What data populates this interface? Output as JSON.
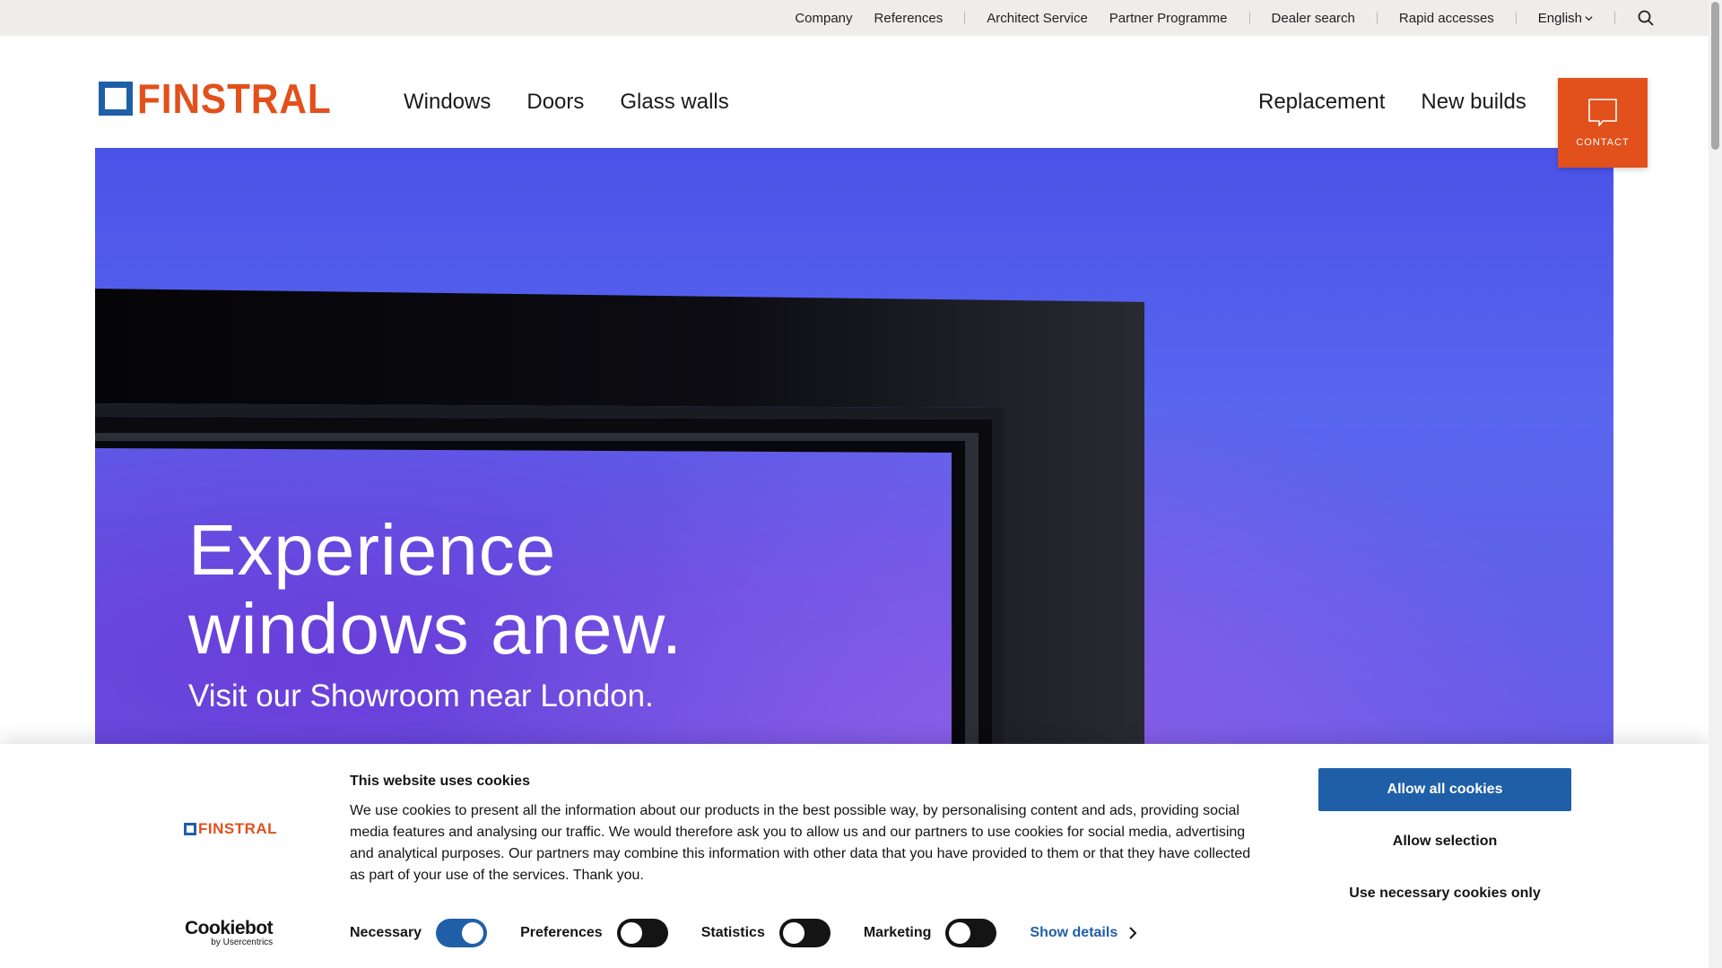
{
  "topbar": {
    "links_a": [
      "Company",
      "References"
    ],
    "links_b": [
      "Architect Service",
      "Partner Programme"
    ],
    "links_c": [
      "Dealer search"
    ],
    "links_d": [
      "Rapid accesses"
    ],
    "language": "English",
    "search_icon": "search-icon"
  },
  "header": {
    "logo_text": "FINSTRAL",
    "nav_left": [
      "Windows",
      "Doors",
      "Glass walls"
    ],
    "nav_right": [
      "Replacement",
      "New builds"
    ],
    "contact_label": "CONTACT",
    "contact_icon": "speech-bubble-icon"
  },
  "hero": {
    "title_line1": "Experience",
    "title_line2": "windows anew.",
    "subtitle": "Visit our Showroom near London."
  },
  "cookie": {
    "logo_text": "FINSTRAL",
    "cookiebot_name": "Cookiebot",
    "cookiebot_by": "by Usercentrics",
    "title": "This website uses cookies",
    "text": "We use cookies to present all the information about our products in the best possible way, by personalising content and ads, providing social media features and analysing our traffic. We would therefore ask you to allow us and our partners to use cookies for social media, advertising and analytical purposes. Our partners may combine this information with other data that you have provided to them or that they have collected as part of your use of the services. Thank you.",
    "toggles": {
      "necessary": {
        "label": "Necessary",
        "on": true
      },
      "preferences": {
        "label": "Preferences",
        "on": false
      },
      "statistics": {
        "label": "Statistics",
        "on": false
      },
      "marketing": {
        "label": "Marketing",
        "on": false
      }
    },
    "show_details": "Show details",
    "allow_all": "Allow all cookies",
    "allow_selection": "Allow selection",
    "necessary_only": "Use necessary cookies only"
  },
  "colors": {
    "brand_orange": "#e2501b",
    "brand_blue": "#1f5fa8",
    "hero_purple": "#5866ee"
  }
}
